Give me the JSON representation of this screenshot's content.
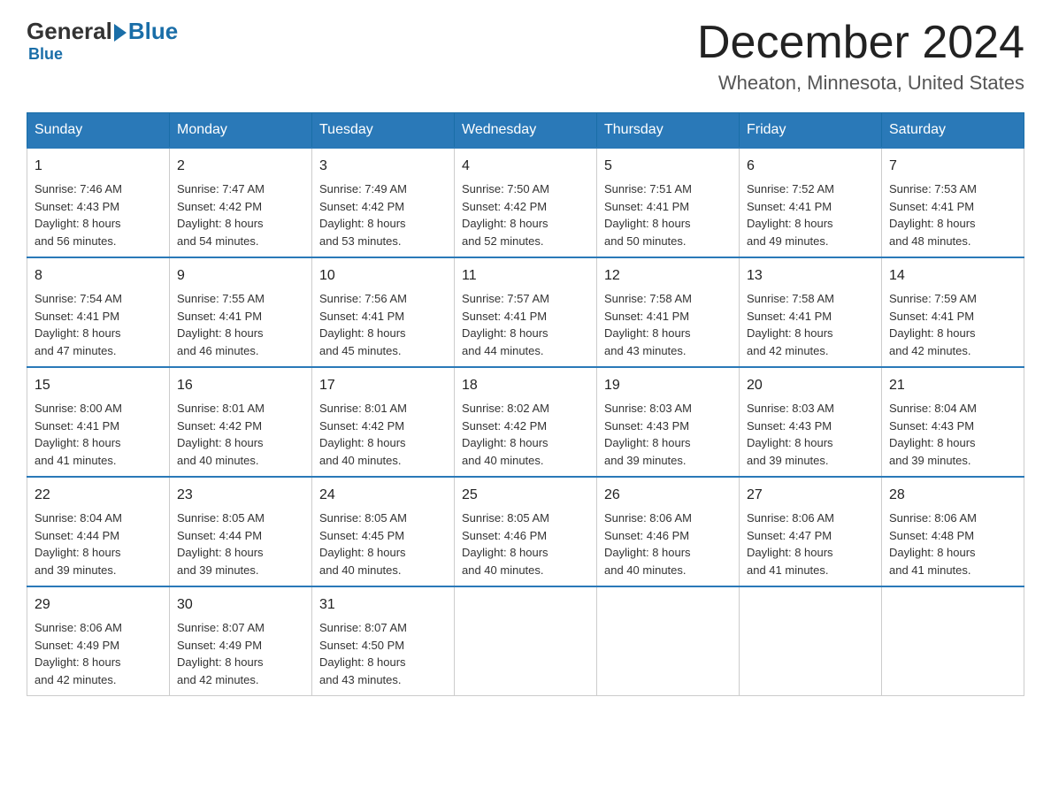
{
  "header": {
    "logo_general": "General",
    "logo_blue": "Blue",
    "month_title": "December 2024",
    "location": "Wheaton, Minnesota, United States"
  },
  "weekdays": [
    "Sunday",
    "Monday",
    "Tuesday",
    "Wednesday",
    "Thursday",
    "Friday",
    "Saturday"
  ],
  "weeks": [
    [
      {
        "day": "1",
        "sunrise": "7:46 AM",
        "sunset": "4:43 PM",
        "daylight": "8 hours and 56 minutes."
      },
      {
        "day": "2",
        "sunrise": "7:47 AM",
        "sunset": "4:42 PM",
        "daylight": "8 hours and 54 minutes."
      },
      {
        "day": "3",
        "sunrise": "7:49 AM",
        "sunset": "4:42 PM",
        "daylight": "8 hours and 53 minutes."
      },
      {
        "day": "4",
        "sunrise": "7:50 AM",
        "sunset": "4:42 PM",
        "daylight": "8 hours and 52 minutes."
      },
      {
        "day": "5",
        "sunrise": "7:51 AM",
        "sunset": "4:41 PM",
        "daylight": "8 hours and 50 minutes."
      },
      {
        "day": "6",
        "sunrise": "7:52 AM",
        "sunset": "4:41 PM",
        "daylight": "8 hours and 49 minutes."
      },
      {
        "day": "7",
        "sunrise": "7:53 AM",
        "sunset": "4:41 PM",
        "daylight": "8 hours and 48 minutes."
      }
    ],
    [
      {
        "day": "8",
        "sunrise": "7:54 AM",
        "sunset": "4:41 PM",
        "daylight": "8 hours and 47 minutes."
      },
      {
        "day": "9",
        "sunrise": "7:55 AM",
        "sunset": "4:41 PM",
        "daylight": "8 hours and 46 minutes."
      },
      {
        "day": "10",
        "sunrise": "7:56 AM",
        "sunset": "4:41 PM",
        "daylight": "8 hours and 45 minutes."
      },
      {
        "day": "11",
        "sunrise": "7:57 AM",
        "sunset": "4:41 PM",
        "daylight": "8 hours and 44 minutes."
      },
      {
        "day": "12",
        "sunrise": "7:58 AM",
        "sunset": "4:41 PM",
        "daylight": "8 hours and 43 minutes."
      },
      {
        "day": "13",
        "sunrise": "7:58 AM",
        "sunset": "4:41 PM",
        "daylight": "8 hours and 42 minutes."
      },
      {
        "day": "14",
        "sunrise": "7:59 AM",
        "sunset": "4:41 PM",
        "daylight": "8 hours and 42 minutes."
      }
    ],
    [
      {
        "day": "15",
        "sunrise": "8:00 AM",
        "sunset": "4:41 PM",
        "daylight": "8 hours and 41 minutes."
      },
      {
        "day": "16",
        "sunrise": "8:01 AM",
        "sunset": "4:42 PM",
        "daylight": "8 hours and 40 minutes."
      },
      {
        "day": "17",
        "sunrise": "8:01 AM",
        "sunset": "4:42 PM",
        "daylight": "8 hours and 40 minutes."
      },
      {
        "day": "18",
        "sunrise": "8:02 AM",
        "sunset": "4:42 PM",
        "daylight": "8 hours and 40 minutes."
      },
      {
        "day": "19",
        "sunrise": "8:03 AM",
        "sunset": "4:43 PM",
        "daylight": "8 hours and 39 minutes."
      },
      {
        "day": "20",
        "sunrise": "8:03 AM",
        "sunset": "4:43 PM",
        "daylight": "8 hours and 39 minutes."
      },
      {
        "day": "21",
        "sunrise": "8:04 AM",
        "sunset": "4:43 PM",
        "daylight": "8 hours and 39 minutes."
      }
    ],
    [
      {
        "day": "22",
        "sunrise": "8:04 AM",
        "sunset": "4:44 PM",
        "daylight": "8 hours and 39 minutes."
      },
      {
        "day": "23",
        "sunrise": "8:05 AM",
        "sunset": "4:44 PM",
        "daylight": "8 hours and 39 minutes."
      },
      {
        "day": "24",
        "sunrise": "8:05 AM",
        "sunset": "4:45 PM",
        "daylight": "8 hours and 40 minutes."
      },
      {
        "day": "25",
        "sunrise": "8:05 AM",
        "sunset": "4:46 PM",
        "daylight": "8 hours and 40 minutes."
      },
      {
        "day": "26",
        "sunrise": "8:06 AM",
        "sunset": "4:46 PM",
        "daylight": "8 hours and 40 minutes."
      },
      {
        "day": "27",
        "sunrise": "8:06 AM",
        "sunset": "4:47 PM",
        "daylight": "8 hours and 41 minutes."
      },
      {
        "day": "28",
        "sunrise": "8:06 AM",
        "sunset": "4:48 PM",
        "daylight": "8 hours and 41 minutes."
      }
    ],
    [
      {
        "day": "29",
        "sunrise": "8:06 AM",
        "sunset": "4:49 PM",
        "daylight": "8 hours and 42 minutes."
      },
      {
        "day": "30",
        "sunrise": "8:07 AM",
        "sunset": "4:49 PM",
        "daylight": "8 hours and 42 minutes."
      },
      {
        "day": "31",
        "sunrise": "8:07 AM",
        "sunset": "4:50 PM",
        "daylight": "8 hours and 43 minutes."
      },
      null,
      null,
      null,
      null
    ]
  ],
  "labels": {
    "sunrise": "Sunrise:",
    "sunset": "Sunset:",
    "daylight": "Daylight:"
  }
}
